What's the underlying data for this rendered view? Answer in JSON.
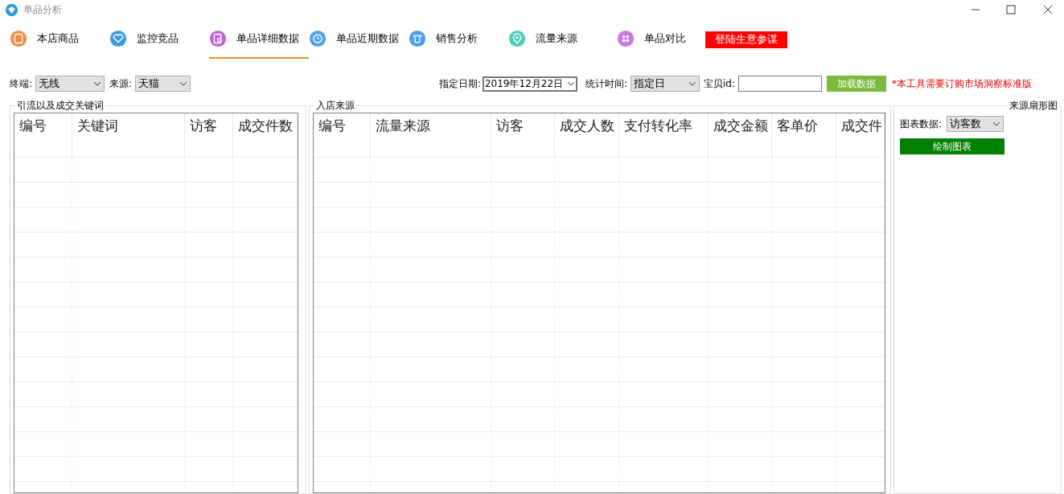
{
  "window": {
    "title": "单品分析"
  },
  "tabs": [
    {
      "label": "本店商品",
      "selected": false,
      "color": "#f08a4b"
    },
    {
      "label": "监控竞品",
      "selected": false,
      "color": "#3a9be8"
    },
    {
      "label": "单品详细数据",
      "selected": true,
      "color": "#c264d6"
    },
    {
      "label": "单品近期数据",
      "selected": false,
      "color": "#4fa3ea"
    },
    {
      "label": "销售分析",
      "selected": false,
      "color": "#4a9ff0"
    },
    {
      "label": "流量来源",
      "selected": false,
      "color": "#4ecdb9"
    },
    {
      "label": "单品对比",
      "selected": false,
      "color": "#c879e0"
    }
  ],
  "login_button": "登陆生意参谋",
  "filters": {
    "terminal_label": "终端:",
    "terminal_value": "无线",
    "source_label": "来源:",
    "source_value": "天猫",
    "date_label": "指定日期:",
    "date_value": "2019年12月22日",
    "period_label": "统计时间:",
    "period_value": "指定日",
    "item_id_label": "宝贝id:",
    "load_button": "加载数据",
    "notice": "*本工具需要订购市场洞察标准版"
  },
  "keywords_panel": {
    "title": "引流以及成交关键词",
    "columns": [
      "编号",
      "关键词",
      "访客",
      "成交件数"
    ]
  },
  "sources_panel": {
    "title": "入店来源",
    "columns": [
      "编号",
      "流量来源",
      "访客",
      "成交人数",
      "支付转化率",
      "成交金额",
      "客单价",
      "成交件"
    ]
  },
  "chart_panel": {
    "title": "来源扇形图",
    "chart_data_label": "图表数据:",
    "chart_data_value": "访客数",
    "draw_button": "绘制图表"
  }
}
